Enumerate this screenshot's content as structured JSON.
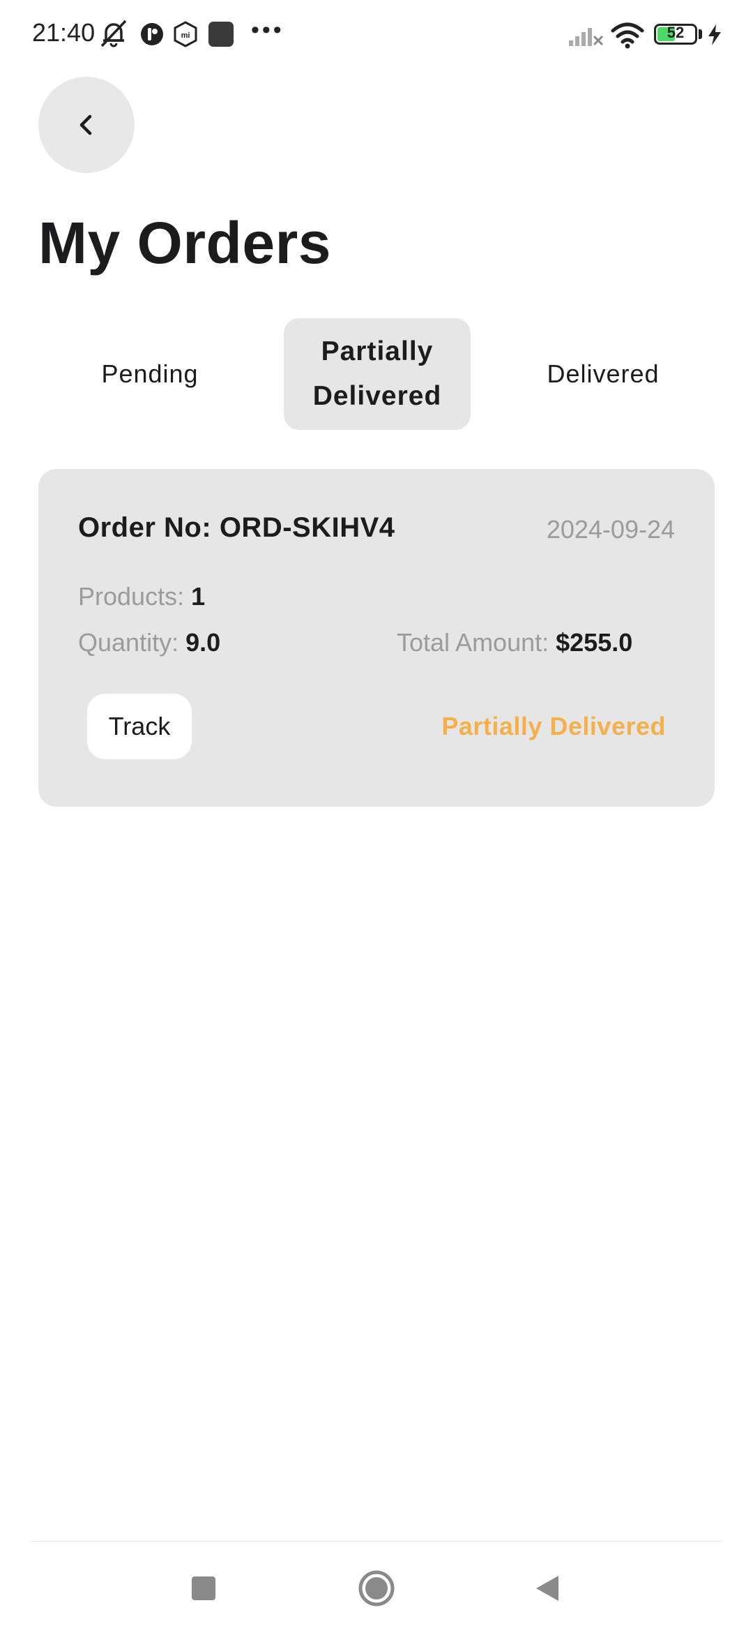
{
  "status_bar": {
    "time": "21:40",
    "battery_level": "52",
    "battery_fraction": 0.52,
    "colors": {
      "battery_fill": "#4cd964"
    }
  },
  "header": {
    "back_icon": "chevron-left-icon",
    "title": "My Orders"
  },
  "tabs": [
    {
      "label": "Pending",
      "active": false
    },
    {
      "label": "Partially Delivered",
      "active": true
    },
    {
      "label": "Delivered",
      "active": false
    }
  ],
  "orders": [
    {
      "order_no_label": "Order No:",
      "order_no": "ORD-SKIHV4",
      "date": "2024-09-24",
      "products_label": "Products:",
      "products": "1",
      "quantity_label": "Quantity:",
      "quantity": "9.0",
      "total_label": "Total Amount:",
      "total": "$255.0",
      "track_label": "Track",
      "status": "Partially Delivered"
    }
  ],
  "colors": {
    "status_partial": "#f5b04b",
    "card_bg": "#e6e6e6",
    "muted_text": "#9b9b9b"
  },
  "nav_bar": {
    "icons": [
      "recent-apps-icon",
      "home-icon",
      "back-icon"
    ]
  }
}
